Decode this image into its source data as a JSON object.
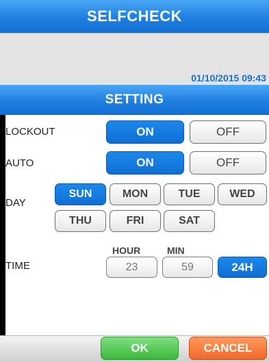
{
  "header": {
    "title": "SELFCHECK"
  },
  "info": {
    "datetime": "01/10/2015 09:43"
  },
  "setting": {
    "title": "SETTING"
  },
  "lockout": {
    "label": "LOCKOUT",
    "on": "ON",
    "off": "OFF",
    "selected": "ON"
  },
  "auto": {
    "label": "AUTO",
    "on": "ON",
    "off": "OFF",
    "selected": "ON"
  },
  "day": {
    "label": "DAY",
    "options": [
      "SUN",
      "MON",
      "TUE",
      "WED",
      "THU",
      "FRI",
      "SAT"
    ],
    "selected": "SUN"
  },
  "time": {
    "label": "TIME",
    "hour_label": "HOUR",
    "min_label": "MIN",
    "hour": "23",
    "min": "59",
    "format_button": "24H"
  },
  "footer": {
    "ok": "OK",
    "cancel": "CANCEL"
  },
  "colors": {
    "accent_blue": "#1270d4",
    "ok_green": "#3cb83c",
    "cancel_orange": "#f0682a"
  }
}
